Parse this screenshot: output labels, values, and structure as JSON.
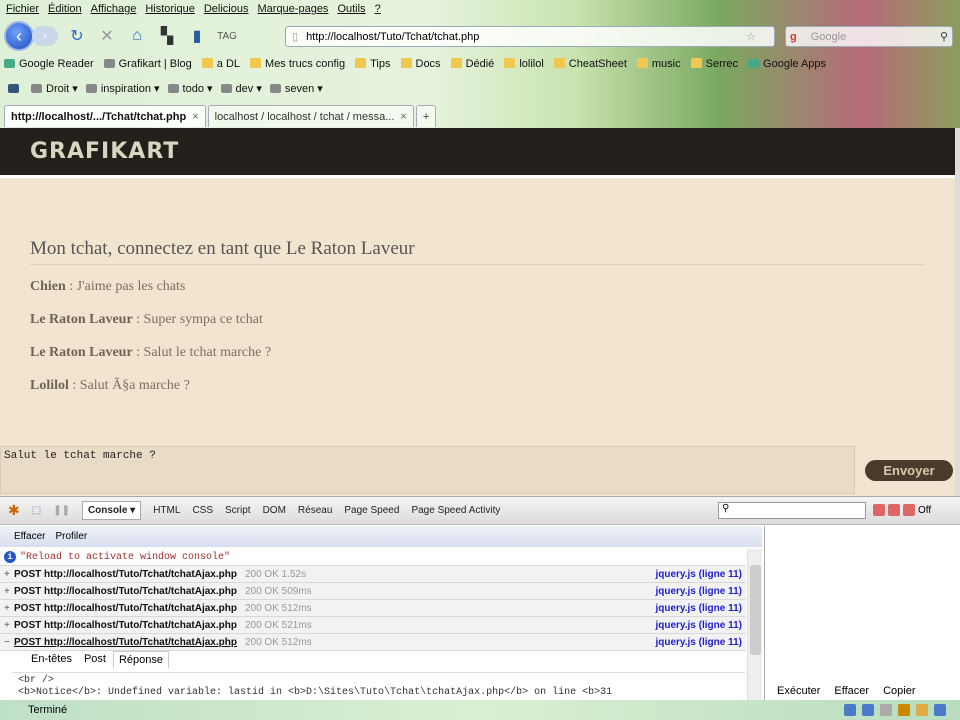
{
  "menu": [
    "Fichier",
    "Édition",
    "Affichage",
    "Historique",
    "Delicious",
    "Marque-pages",
    "Outils",
    "?"
  ],
  "url": "http://localhost/Tuto/Tchat/tchat.php",
  "search_placeholder": "Google",
  "bookmarks": [
    "Google Reader",
    "Grafikart | Blog",
    "a DL",
    "Mes trucs config",
    "Tips",
    "Docs",
    "Dédié",
    "lolilol",
    "CheatSheet",
    "music",
    "Serrec",
    "Google Apps"
  ],
  "bookmarks2": [
    "Droit",
    "inspiration",
    "todo",
    "dev",
    "seven"
  ],
  "tabs": [
    {
      "label": "http://localhost/.../Tchat/tchat.php"
    },
    {
      "label": "localhost / localhost / tchat / messa..."
    }
  ],
  "site": {
    "logo": "GRAFIKART",
    "title": "Mon tchat, connectez en tant que Le Raton Laveur",
    "messages": [
      {
        "author": "Chien",
        "text": " : J'aime pas les chats"
      },
      {
        "author": "Le Raton Laveur",
        "text": " : Super sympa ce tchat"
      },
      {
        "author": "Le Raton Laveur",
        "text": " : Salut le tchat marche ?"
      },
      {
        "author": "Lolilol",
        "text": " : Salut Ã§a marche ?"
      }
    ],
    "input_value": "Salut le tchat marche ?",
    "send_label": "Envoyer"
  },
  "firebug": {
    "tabs": [
      "Console ▾",
      "HTML",
      "CSS",
      "Script",
      "DOM",
      "Réseau",
      "Page Speed",
      "Page Speed Activity"
    ],
    "off": "Off",
    "sub": [
      "Effacer",
      "Profiler"
    ],
    "info": "\"Reload to activate window console\"",
    "requests": [
      {
        "sign": "+",
        "label": "POST http://localhost/Tuto/Tchat/tchatAjax.php",
        "status": "200 OK 1.52s",
        "src": "jquery.js (ligne 11)"
      },
      {
        "sign": "+",
        "label": "POST http://localhost/Tuto/Tchat/tchatAjax.php",
        "status": "200 OK 509ms",
        "src": "jquery.js (ligne 11)"
      },
      {
        "sign": "+",
        "label": "POST http://localhost/Tuto/Tchat/tchatAjax.php",
        "status": "200 OK 512ms",
        "src": "jquery.js (ligne 11)"
      },
      {
        "sign": "+",
        "label": "POST http://localhost/Tuto/Tchat/tchatAjax.php",
        "status": "200 OK 521ms",
        "src": "jquery.js (ligne 11)"
      },
      {
        "sign": "−",
        "label": "POST http://localhost/Tuto/Tchat/tchatAjax.php",
        "status": "200 OK 512ms",
        "src": "jquery.js (ligne 11)"
      }
    ],
    "detail_tabs": [
      "En-têtes",
      "Post",
      "Réponse"
    ],
    "response": [
      "<br />",
      "<b>Notice</b>:  Undefined variable: lastid in <b>D:\\Sites\\Tuto\\Tchat\\tchatAjax.php</b> on line <b>31"
    ],
    "right_buttons": [
      "Exécuter",
      "Effacer",
      "Copier"
    ]
  },
  "status": "Terminé"
}
